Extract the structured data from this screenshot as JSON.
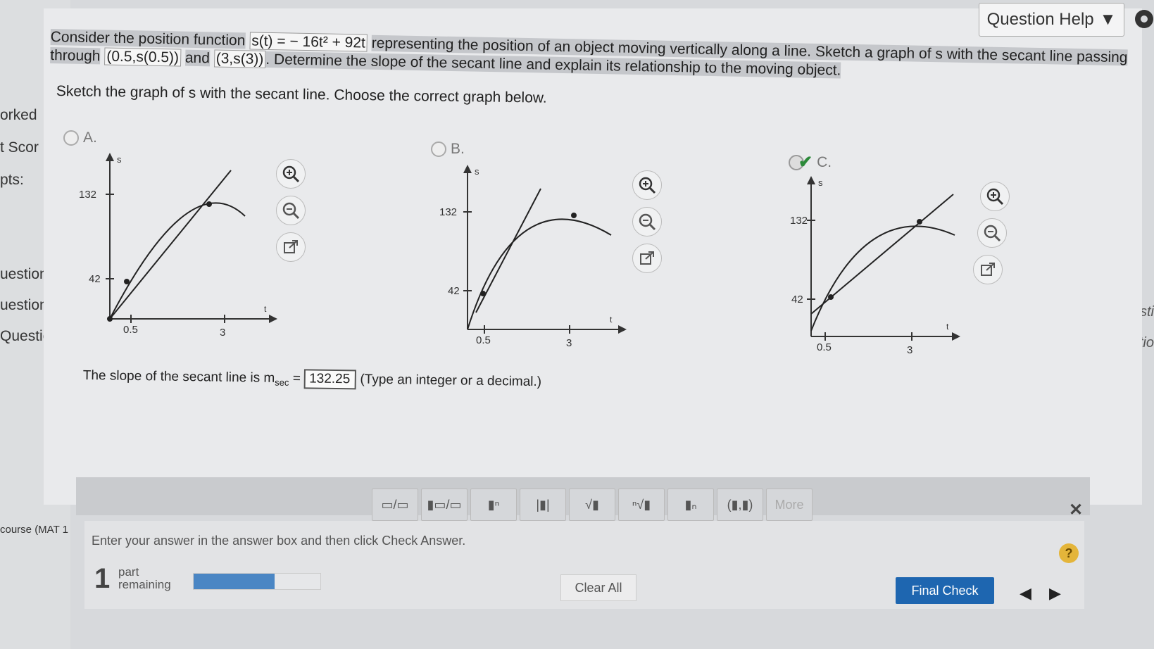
{
  "header": {
    "question_help": "Question Help"
  },
  "left_sidebar": [
    "orked",
    "t Scor",
    "pts:",
    "uestion",
    "uestion",
    "Question"
  ],
  "right_sidebar": [
    "lesti",
    "lestio"
  ],
  "question": {
    "prompt_part1": "Consider the position function",
    "function_text": "s(t) = − 16t² + 92t",
    "prompt_part2": "representing the position of an object moving vertically along a line. Sketch a graph of s with the secant line passing through",
    "point1": "(0.5,s(0.5))",
    "and": "and",
    "point2": "(3,s(3))",
    "prompt_part3": ". Determine the slope of the secant line and explain its relationship to the moving object.",
    "instruction": "Sketch the graph of s with the secant line. Choose the correct graph below."
  },
  "options": [
    {
      "label": "A.",
      "selected": false,
      "graph": {
        "y_label": "s",
        "x_label": "t",
        "y_ticks": [
          "132",
          "42"
        ],
        "x_ticks": [
          "0.5",
          "3"
        ]
      }
    },
    {
      "label": "B.",
      "selected": false,
      "graph": {
        "y_label": "s",
        "x_label": "t",
        "y_ticks": [
          "132",
          "42"
        ],
        "x_ticks": [
          "0.5",
          "3"
        ]
      }
    },
    {
      "label": "C.",
      "selected": true,
      "graph": {
        "y_label": "s",
        "x_label": "t",
        "y_ticks": [
          "132",
          "42"
        ],
        "x_ticks": [
          "0.5",
          "3"
        ]
      }
    }
  ],
  "slope": {
    "text_before": "The slope of the secant line is m",
    "subscript": "sec",
    "equals": " = ",
    "answer_value": "132.25",
    "hint": "(Type an integer or a decimal.)"
  },
  "toolbar": {
    "buttons": [
      {
        "name": "fraction",
        "glyph": "▭/▭"
      },
      {
        "name": "mixed-number",
        "glyph": "▮▭/▭"
      },
      {
        "name": "exponent",
        "glyph": "▮ⁿ"
      },
      {
        "name": "absolute-value",
        "glyph": "|▮|"
      },
      {
        "name": "square-root",
        "glyph": "√▮"
      },
      {
        "name": "nth-root",
        "glyph": "ⁿ√▮"
      },
      {
        "name": "subscript",
        "glyph": "▮ₙ"
      },
      {
        "name": "ordered-pair",
        "glyph": "(▮,▮)"
      },
      {
        "name": "more",
        "glyph": "More"
      }
    ]
  },
  "footer": {
    "course_label": "course (MAT 1",
    "enter_message": "Enter your answer in the answer box and then click Check Answer.",
    "parts_count": "1",
    "parts_word": "part",
    "remaining_word": "remaining",
    "progress_fraction": 0.64,
    "clear_all": "Clear All",
    "final_check": "Final Check"
  }
}
